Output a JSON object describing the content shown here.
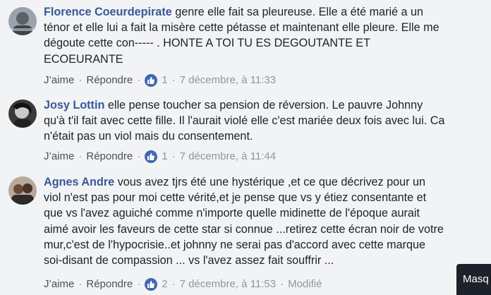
{
  "comments": [
    {
      "author": "Florence Coeurdepirate",
      "text_lines": [
        " genre elle fait sa pleureuse. Elle a été marié a un",
        "ténor et elle lui a fait la misère cette pétasse et maintenant elle pleure. Elle me",
        "dégoute cette con----- . HONTE A TOI TU ES DEGOUTANTE ET",
        "ECOEURANTE"
      ],
      "like_label": "J’aime",
      "reply_label": "Répondre",
      "reaction_count": "1",
      "time": "7 décembre, à 11:33",
      "modified": ""
    },
    {
      "author": "Josy Lottin",
      "text_lines": [
        " elle pense toucher sa pension de réversion. Le pauvre Johnny",
        "qu'à t'il fait avec cette fille. Il l'aurait violé elle c'est mariée deux fois avec lui. Ca",
        "n'était pas un viol mais du consentement."
      ],
      "like_label": "J’aime",
      "reply_label": "Répondre",
      "reaction_count": "1",
      "time": "7 décembre, à 11:44",
      "modified": ""
    },
    {
      "author": "Agnes Andre",
      "text_lines": [
        " vous avez tjrs été une hystérique ,et ce que décrivez pour un",
        "viol n'est pas pour moi cette vérité,et je pense que vs y étiez consentante et",
        "que vs l'avez aguiché comme n'importe quelle midinette de l'époque aurait",
        "aimé avoir les faveurs de cette star si connue ...retirez cette écran noir de votre",
        "mur,c'est de l'hypocrisie..et johnny ne serai pas d'accord avec cette marque",
        "soi-disant de compassion ... vs l'avez assez fait souffrir ..."
      ],
      "like_label": "J’aime",
      "reply_label": "Répondre",
      "reaction_count": "2",
      "time": "7 décembre, à 11:53",
      "modified": "Modifié"
    }
  ],
  "overlay_button": "Masq",
  "colors": {
    "name": "#385898",
    "like_badge": "#4267b2",
    "meta": "#90949c",
    "background": "#f2f3f5"
  },
  "icons": {
    "like": "thumbs-up-icon"
  }
}
